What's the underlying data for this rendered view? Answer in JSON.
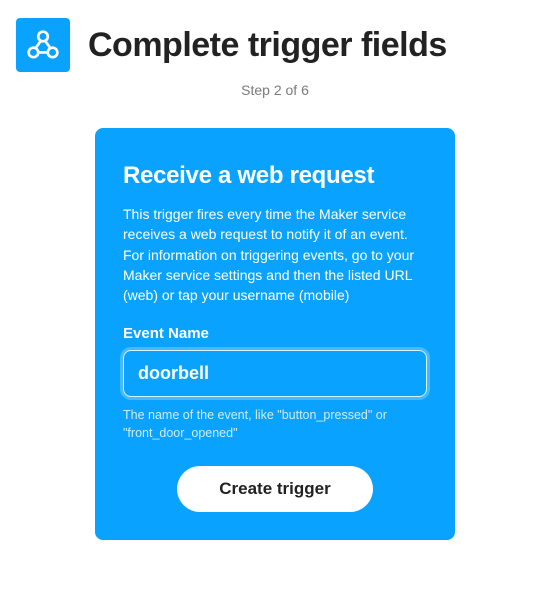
{
  "colors": {
    "accent": "#09a3ff",
    "ink": "#222222",
    "muted": "#7a7a7a"
  },
  "header": {
    "icon": "webhook-icon",
    "title": "Complete trigger fields"
  },
  "step": "Step 2 of 6",
  "card": {
    "title": "Receive a web request",
    "description": "This trigger fires every time the Maker service receives a web request to notify it of an event. For information on triggering events, go to your Maker service settings and then the listed URL (web) or tap your username (mobile)",
    "field": {
      "label": "Event Name",
      "value": "doorbell",
      "placeholder": "",
      "hint": "The name of the event, like \"button_pressed\" or \"front_door_opened\""
    },
    "submit_label": "Create trigger"
  }
}
